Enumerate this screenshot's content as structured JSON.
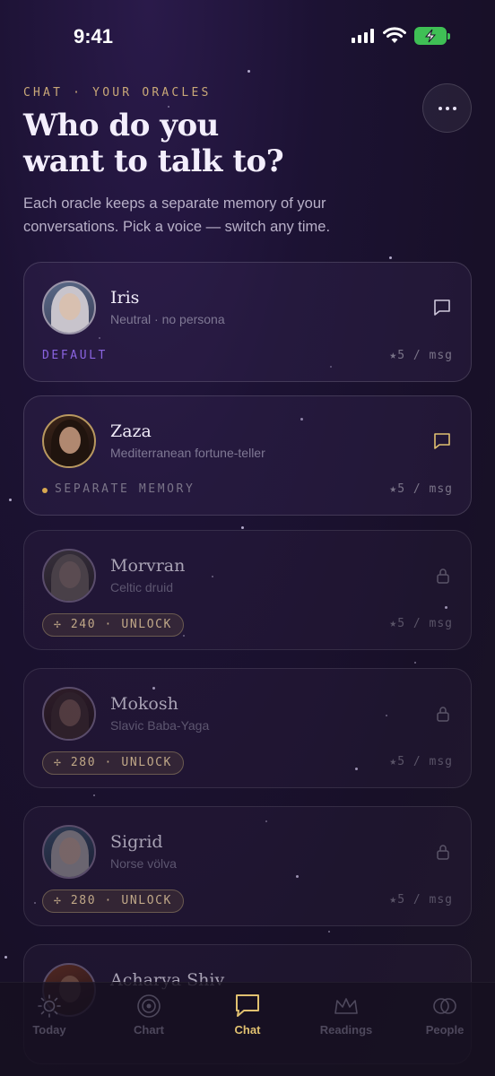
{
  "status_bar": {
    "time": "9:41"
  },
  "header": {
    "eyebrow": "CHAT · YOUR ORACLES",
    "title_line1": "Who do you",
    "title_line2": "want to talk to?",
    "subtitle": "Each oracle keeps a separate memory of your conversations. Pick a voice — switch any time.",
    "more_icon": "ellipsis-icon"
  },
  "oracles": [
    {
      "name": "Iris",
      "description": "Neutral · no persona",
      "tag": "DEFAULT",
      "price": "★5 / msg",
      "action_icon": "chat-bubble-icon"
    },
    {
      "name": "Zaza",
      "description": "Mediterranean fortune-teller",
      "tag": "SEPARATE MEMORY",
      "price": "★5 / msg",
      "action_icon": "chat-bubble-icon"
    },
    {
      "name": "Morvran",
      "description": "Celtic druid",
      "unlock": "✢ 240 · UNLOCK",
      "price": "★5 / msg",
      "action_icon": "lock-icon"
    },
    {
      "name": "Mokosh",
      "description": "Slavic Baba-Yaga",
      "unlock": "✢ 280 · UNLOCK",
      "price": "★5 / msg",
      "action_icon": "lock-icon"
    },
    {
      "name": "Sigrid",
      "description": "Norse völva",
      "unlock": "✢ 280 · UNLOCK",
      "price": "★5 / msg",
      "action_icon": "lock-icon"
    },
    {
      "name": "Acharya Shiv"
    }
  ],
  "tabbar": {
    "tabs": [
      {
        "label": "Today",
        "icon": "sun-icon"
      },
      {
        "label": "Chart",
        "icon": "target-icon"
      },
      {
        "label": "Chat",
        "icon": "chat-bubble-icon",
        "active": true
      },
      {
        "label": "Readings",
        "icon": "crown-icon"
      },
      {
        "label": "People",
        "icon": "interlocking-rings-icon"
      }
    ]
  },
  "colors": {
    "accent_gold": "#e0c070",
    "default_tag": "#8a64e0",
    "memory_dot": "#d8a850",
    "battery": "#3fbf55"
  }
}
